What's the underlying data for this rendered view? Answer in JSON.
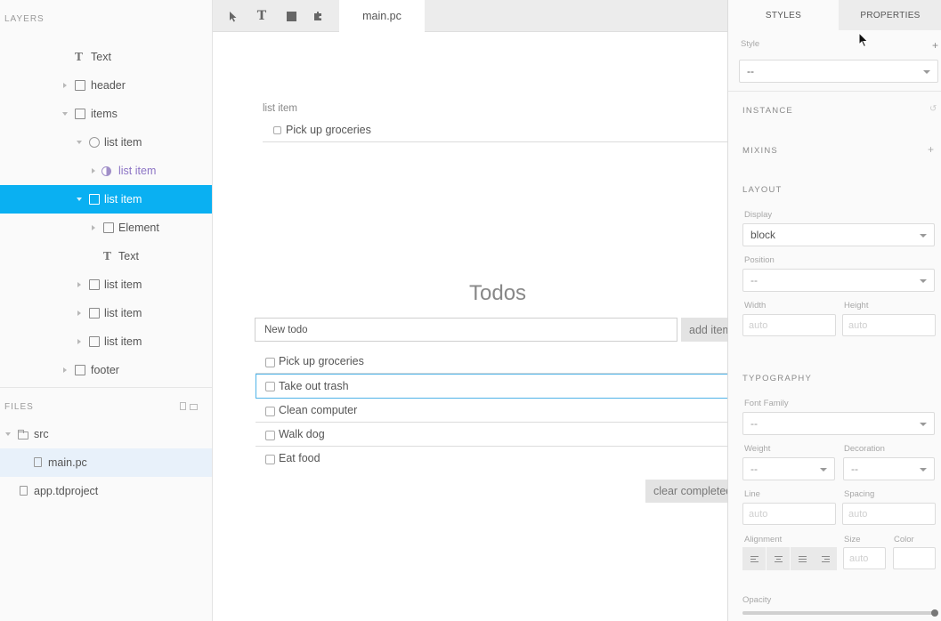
{
  "sidebar": {
    "layers_title": "LAYERS",
    "layers": [
      {
        "label": "Text",
        "icon": "text-icon",
        "indent": 80,
        "arrow": "none"
      },
      {
        "label": "header",
        "icon": "box-icon",
        "indent": 84,
        "arrow": "right"
      },
      {
        "label": "items",
        "icon": "box-icon",
        "indent": 84,
        "arrow": "down"
      },
      {
        "label": "list item",
        "icon": "circle-icon",
        "indent": 100,
        "arrow": "down"
      },
      {
        "label": "list item",
        "icon": "component-icon",
        "indent": 116,
        "arrow": "right"
      },
      {
        "label": "list item",
        "icon": "box-icon",
        "indent": 100,
        "arrow": "down",
        "selected": true
      },
      {
        "label": "Element",
        "icon": "box-icon",
        "indent": 116,
        "arrow": "right"
      },
      {
        "label": "Text",
        "icon": "text-icon",
        "indent": 116,
        "arrow": "none"
      },
      {
        "label": "list item",
        "icon": "box-icon",
        "indent": 100,
        "arrow": "right"
      },
      {
        "label": "list item",
        "icon": "box-icon",
        "indent": 100,
        "arrow": "right"
      },
      {
        "label": "list item",
        "icon": "box-icon",
        "indent": 100,
        "arrow": "right"
      },
      {
        "label": "footer",
        "icon": "box-icon",
        "indent": 84,
        "arrow": "right"
      }
    ],
    "files_title": "FILES",
    "files": [
      {
        "label": "src",
        "icon": "folder-icon"
      },
      {
        "label": "main.pc",
        "icon": "file-icon"
      },
      {
        "label": "app.tdproject",
        "icon": "file-icon"
      }
    ]
  },
  "toolbar": {
    "tools": [
      "pointer-icon",
      "text-tool-icon",
      "rectangle-tool-icon",
      "component-tool-icon"
    ],
    "tab_label": "main.pc"
  },
  "canvas": {
    "list_item_label": "list item",
    "list_item_text": "Pick up groceries",
    "heading": "Todos",
    "new_todo_value": "New todo",
    "add_button": "add item",
    "todos": [
      "Pick up groceries",
      "Take out trash",
      "Clean computer",
      "Walk dog",
      "Eat food"
    ],
    "clear_button": "clear completed"
  },
  "panel": {
    "tab_styles": "STYLES",
    "tab_properties": "PROPERTIES",
    "style_label": "Style",
    "style_value": "--",
    "instance_title": "INSTANCE",
    "mixins_title": "MIXINS",
    "layout_title": "LAYOUT",
    "display_label": "Display",
    "display_value": "block",
    "position_label": "Position",
    "position_value": "--",
    "width_label": "Width",
    "height_label": "Height",
    "width_placeholder": "auto",
    "height_placeholder": "auto",
    "typography_title": "TYPOGRAPHY",
    "font_family_label": "Font Family",
    "font_family_value": "--",
    "weight_label": "Weight",
    "weight_value": "--",
    "decoration_label": "Decoration",
    "decoration_value": "--",
    "line_label": "Line",
    "spacing_label": "Spacing",
    "line_placeholder": "auto",
    "spacing_placeholder": "auto",
    "alignment_label": "Alignment",
    "size_label": "Size",
    "color_label": "Color",
    "size_placeholder": "auto",
    "opacity_label": "Opacity",
    "opacity_value": 1.0
  },
  "colors": {
    "selection": "#0ab0f2",
    "highlight_border": "#4fb3e8",
    "component_purple": "#8c74c5"
  }
}
